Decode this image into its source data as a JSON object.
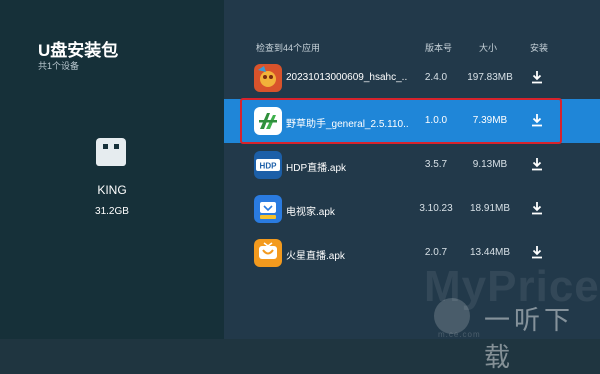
{
  "left_panel": {
    "title": "U盘安装包",
    "subtitle": "共1个设备",
    "device": {
      "name": "KING",
      "size": "31.2GB",
      "icon": "usb-drive-icon"
    }
  },
  "table": {
    "header": {
      "count": "检查到44个应用",
      "version": "版本号",
      "size": "大小",
      "install": "安装"
    },
    "rows": [
      {
        "name": "20231013000609_hsahc_..",
        "version": "2.4.0",
        "size": "197.83MB",
        "icon": "game-app-icon",
        "selected": false
      },
      {
        "name": "野草助手_general_2.5.110..",
        "version": "1.0.0",
        "size": "7.39MB",
        "icon": "yecao-app-icon",
        "selected": true
      },
      {
        "name": "HDP直播.apk",
        "version": "3.5.7",
        "size": "9.13MB",
        "icon": "hdp-app-icon",
        "selected": false
      },
      {
        "name": "电视家.apk",
        "version": "3.10.23",
        "size": "18.91MB",
        "icon": "tv-home-app-icon",
        "selected": false
      },
      {
        "name": "火星直播.apk",
        "version": "2.0.7",
        "size": "13.44MB",
        "icon": "mars-live-app-icon",
        "selected": false
      }
    ],
    "install_icon": "download-icon"
  },
  "watermark": {
    "brand": "MyPrice",
    "chinese": "一听下载",
    "url": "m.ce.com"
  },
  "colors": {
    "left_bg": "#163039",
    "right_bg": "#22394a",
    "selected_row": "#1f86d8",
    "selection_border": "#d7232c"
  }
}
